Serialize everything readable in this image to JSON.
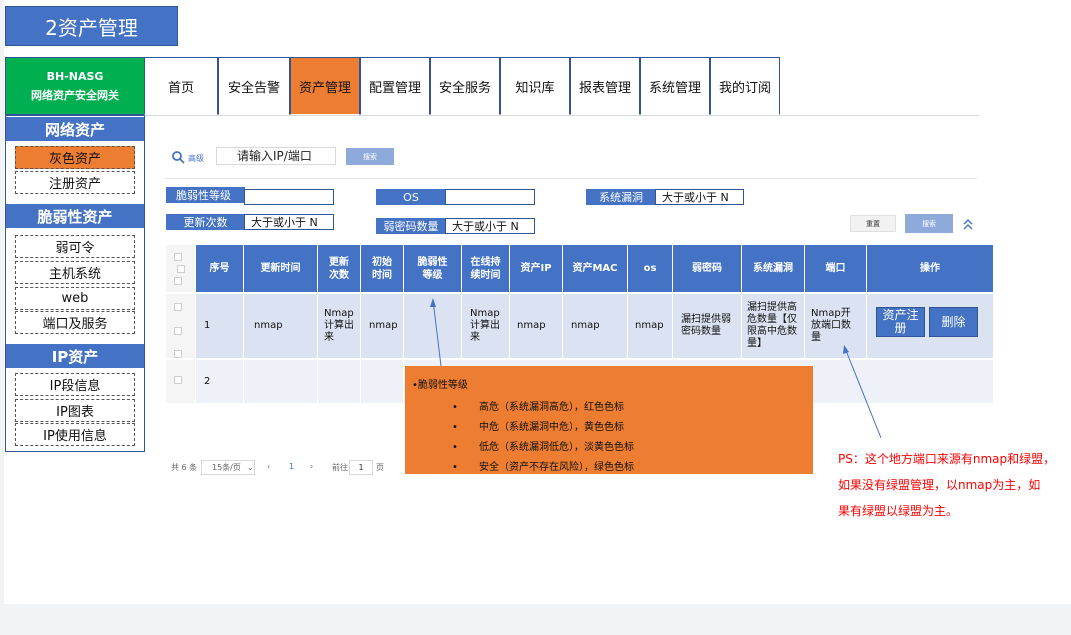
{
  "page_title": "2资产管理",
  "brand": {
    "line1": "BH-NASG",
    "line2": "网络资产安全网关"
  },
  "nav": [
    {
      "label": "首页"
    },
    {
      "label": "安全告警"
    },
    {
      "label": "资产管理",
      "active": true
    },
    {
      "label": "配置管理"
    },
    {
      "label": "安全服务"
    },
    {
      "label": "知识库"
    },
    {
      "label": "报表管理"
    },
    {
      "label": "系统管理"
    },
    {
      "label": "我的订阅"
    }
  ],
  "sidebar": {
    "sections": [
      {
        "title": "网络资产",
        "items": [
          "灰色资产",
          "注册资产"
        ]
      },
      {
        "title": "脆弱性资产",
        "items": [
          "弱可令",
          "主机系统",
          "web",
          "端口及服务"
        ]
      },
      {
        "title": "IP资产",
        "items": [
          "IP段信息",
          "IP图表",
          "IP使用信息"
        ]
      }
    ],
    "active_item": "灰色资产"
  },
  "search": {
    "advanced_label": "高级",
    "placeholder": "请输入IP/端口",
    "button": "搜索"
  },
  "filters": {
    "vuln_level_label": "脆弱性等级",
    "os_label": "OS",
    "sys_vuln_label": "系统漏洞",
    "sys_vuln_value": "大于或小于 N",
    "update_count_label": "更新次数",
    "update_count_value": "大于或小于 N",
    "weak_pwd_label": "弱密码数量",
    "weak_pwd_value": "大于或小于 N",
    "reset_button": "重置",
    "search_button": "搜索"
  },
  "table": {
    "headers": [
      "序号",
      "更新时间",
      "更新次数",
      "初始时间",
      "脆弱性等级",
      "在线持续时间",
      "资产IP",
      "资产MAC",
      "os",
      "弱密码",
      "系统漏洞",
      "端口",
      "操作"
    ],
    "rows": [
      {
        "no": "1",
        "update_time": "nmap",
        "update_count": "Nmap计算出来",
        "init_time": "nmap",
        "vuln_level": "",
        "online": "Nmap计算出来",
        "ip": "nmap",
        "mac": "nmap",
        "os": "nmap",
        "weak_pwd": "漏扫提供弱密码数量",
        "sys_vuln": "漏扫提供高危数量【仅限高中危数量】",
        "port": "Nmap开放端口数量",
        "op_register": "资产注册",
        "op_delete": "删除"
      },
      {
        "no": "2"
      }
    ]
  },
  "pagination": {
    "total": "共 6 条",
    "page_size": "15条/页",
    "current": "1",
    "goto_label": "前往",
    "goto_value": "1",
    "page_suffix": "页"
  },
  "note": {
    "title": "•脆弱性等级",
    "bullet": "•",
    "items": [
      "高危（系统漏洞高危），红色色标",
      "中危（系统漏洞中危），黄色色标",
      "低危（系统漏洞低危），淡黄色色标",
      "安全（资产不存在风险），绿色色标"
    ]
  },
  "ps_note": [
    "PS：这个地方端口来源有nmap和绿盟，",
    "如果没有绿盟管理，以nmap为主，如",
    "果有绿盟以绿盟为主。"
  ],
  "colors": {
    "accent_blue": "#4472c4",
    "active_orange": "#ed7d31",
    "brand_green": "#00b050",
    "ps_red": "#ff0000"
  }
}
